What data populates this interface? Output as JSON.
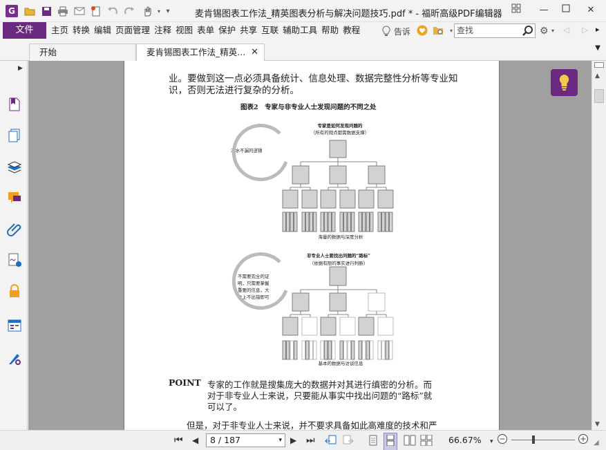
{
  "window": {
    "title": "麦肯锡图表工作法_精英图表分析与解决问题技巧.pdf * - 福昕高级PDF编辑器",
    "logo_letter": "G"
  },
  "menu": {
    "file": "文件",
    "items": [
      "主页",
      "转换",
      "编辑",
      "页面管理",
      "注释",
      "视图",
      "表单",
      "保护",
      "共享",
      "互联",
      "辅助工具",
      "帮助",
      "教程"
    ],
    "tell_me": "告诉",
    "search_placeholder": "查找"
  },
  "tabs": {
    "start": "开始",
    "document": "麦肯锡图表工作法_精英..."
  },
  "document": {
    "line1": "业。要做到这一点必须具备统计、信息处理、数据完整性分析等专业知",
    "line2": "识，否则无法进行复杂的分析。",
    "figure_caption": "图表2　专家与非专业人士发现问题的不同之处",
    "expert": {
      "heading": "专家是如何发现问题的",
      "subheading": "（所有的观点都需数据支撑）",
      "bubble": "滴水不漏的逻辑",
      "footer": "海量的数据与深度分析"
    },
    "novice": {
      "heading": "非专业人士要找出问题的“路标”",
      "subheading": "（依据有限的事实进行判断）",
      "bubble_lines": [
        "不需要完全的证",
        "明，只需要掌握",
        "重要的信息，大",
        "体上不出错即可"
      ],
      "footer": "基本的数据与访谈信息"
    },
    "point_label": "POINT",
    "point_line1": "专家的工作就是搜集庞大的数据并对其进行缜密的分析。而",
    "point_line2": "对于非专业人士来说，只要能从事实中找出问题的“路标”就",
    "point_line3": "可以了。",
    "last_line": "但是，对于非专业人士来说，并不要求具备如此高难度的技术和严"
  },
  "status": {
    "page_display": "8 / 187",
    "zoom": "66.67%"
  }
}
